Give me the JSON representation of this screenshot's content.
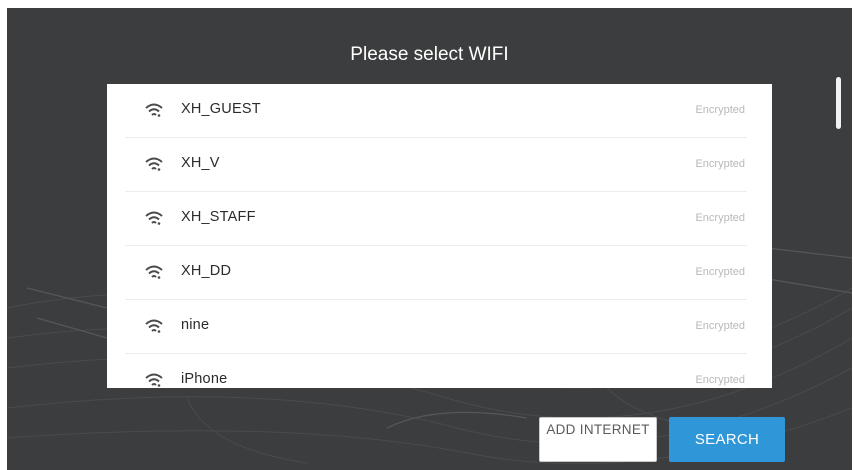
{
  "dialog": {
    "title": "Please select WIFI"
  },
  "networks": [
    {
      "ssid": "XH_GUEST",
      "status": "Encrypted"
    },
    {
      "ssid": "XH_V",
      "status": "Encrypted"
    },
    {
      "ssid": "XH_STAFF",
      "status": "Encrypted"
    },
    {
      "ssid": "XH_DD",
      "status": "Encrypted"
    },
    {
      "ssid": "nine",
      "status": "Encrypted"
    },
    {
      "ssid": "iPhone",
      "status": "Encrypted"
    }
  ],
  "buttons": {
    "add_internet": "ADD INTERNET",
    "search": "SEARCH"
  },
  "icons": {
    "network": "wifi-icon",
    "scroll": "scrollbar-thumb"
  },
  "colors": {
    "background": "#3c3d3e",
    "panel": "#ffffff",
    "primary_button": "#2f96d8",
    "muted_text": "#b9b9b9"
  }
}
